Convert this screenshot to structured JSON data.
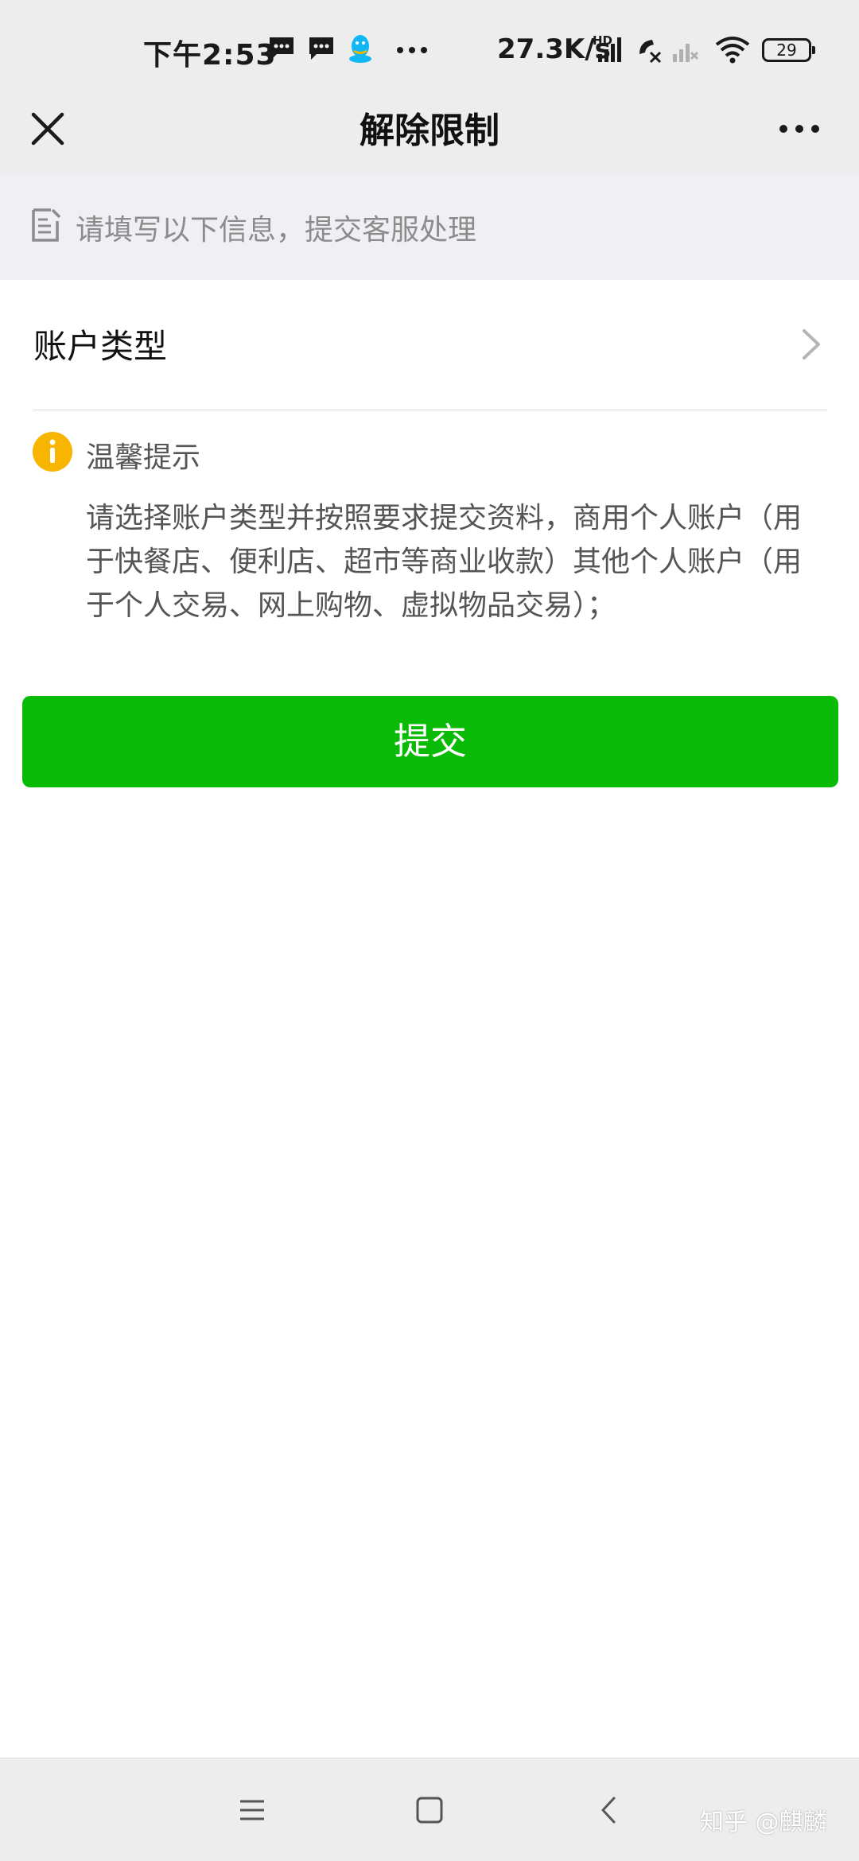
{
  "status_bar": {
    "time": "下午2:53",
    "network_speed": "27.3K/s",
    "hd_label": "HD",
    "battery": "29"
  },
  "nav": {
    "title": "解除限制"
  },
  "tip_banner": {
    "text": "请填写以下信息，提交客服处理"
  },
  "account_type": {
    "label": "账户类型"
  },
  "notice": {
    "title": "温馨提示",
    "body": "请选择账户类型并按照要求提交资料，商用个人账户（用于快餐店、便利店、超市等商业收款）其他个人账户（用于个人交易、网上购物、虚拟物品交易）；"
  },
  "submit": {
    "label": "提交"
  },
  "watermark": {
    "text": "知乎 @麒麟"
  },
  "colors": {
    "primary_green": "#09bb07",
    "notice_icon": "#f7b500",
    "header_bg": "#ededed",
    "banner_bg": "#efeff4"
  }
}
